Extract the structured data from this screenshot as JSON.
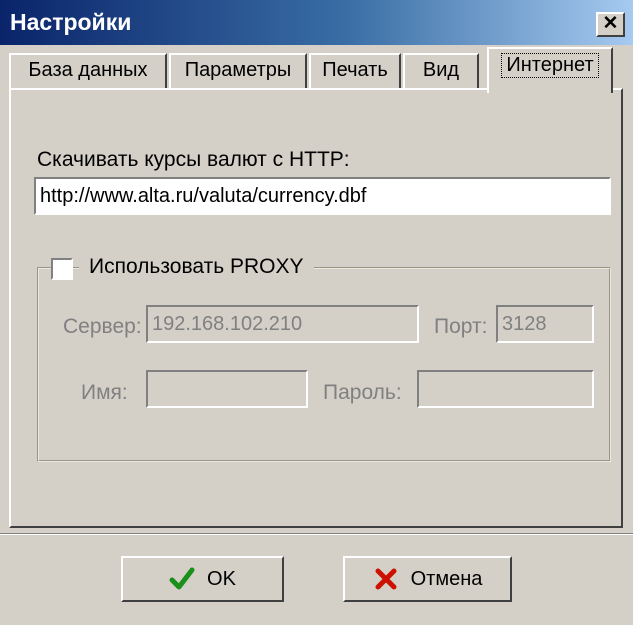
{
  "window": {
    "title": "Настройки",
    "close_glyph": "✕"
  },
  "tabs": [
    {
      "label": "База данных",
      "active": false
    },
    {
      "label": "Параметры",
      "active": false
    },
    {
      "label": "Печать",
      "active": false
    },
    {
      "label": "Вид",
      "active": false
    },
    {
      "label": "Интернет",
      "active": true
    }
  ],
  "internet": {
    "url_label": "Скачивать курсы валют с HTTP:",
    "url_value": "http://www.alta.ru/valuta/currency.dbf",
    "proxy": {
      "checkbox_label": "Использовать PROXY",
      "checked": false,
      "server_label": "Сервер:",
      "server_value": "192.168.102.210",
      "port_label": "Порт:",
      "port_value": "3128",
      "name_label": "Имя:",
      "name_value": "",
      "password_label": "Пароль:",
      "password_value": ""
    }
  },
  "buttons": {
    "ok_label": "OK",
    "ok_icon": "checkmark-icon",
    "cancel_label": "Отмена",
    "cancel_icon": "red-x-icon"
  },
  "colors": {
    "title_bar": "#0a246a",
    "dialog_bg": "#d4d0c8",
    "ok_icon": "#1a8f1a",
    "cancel_icon": "#cc1100"
  }
}
